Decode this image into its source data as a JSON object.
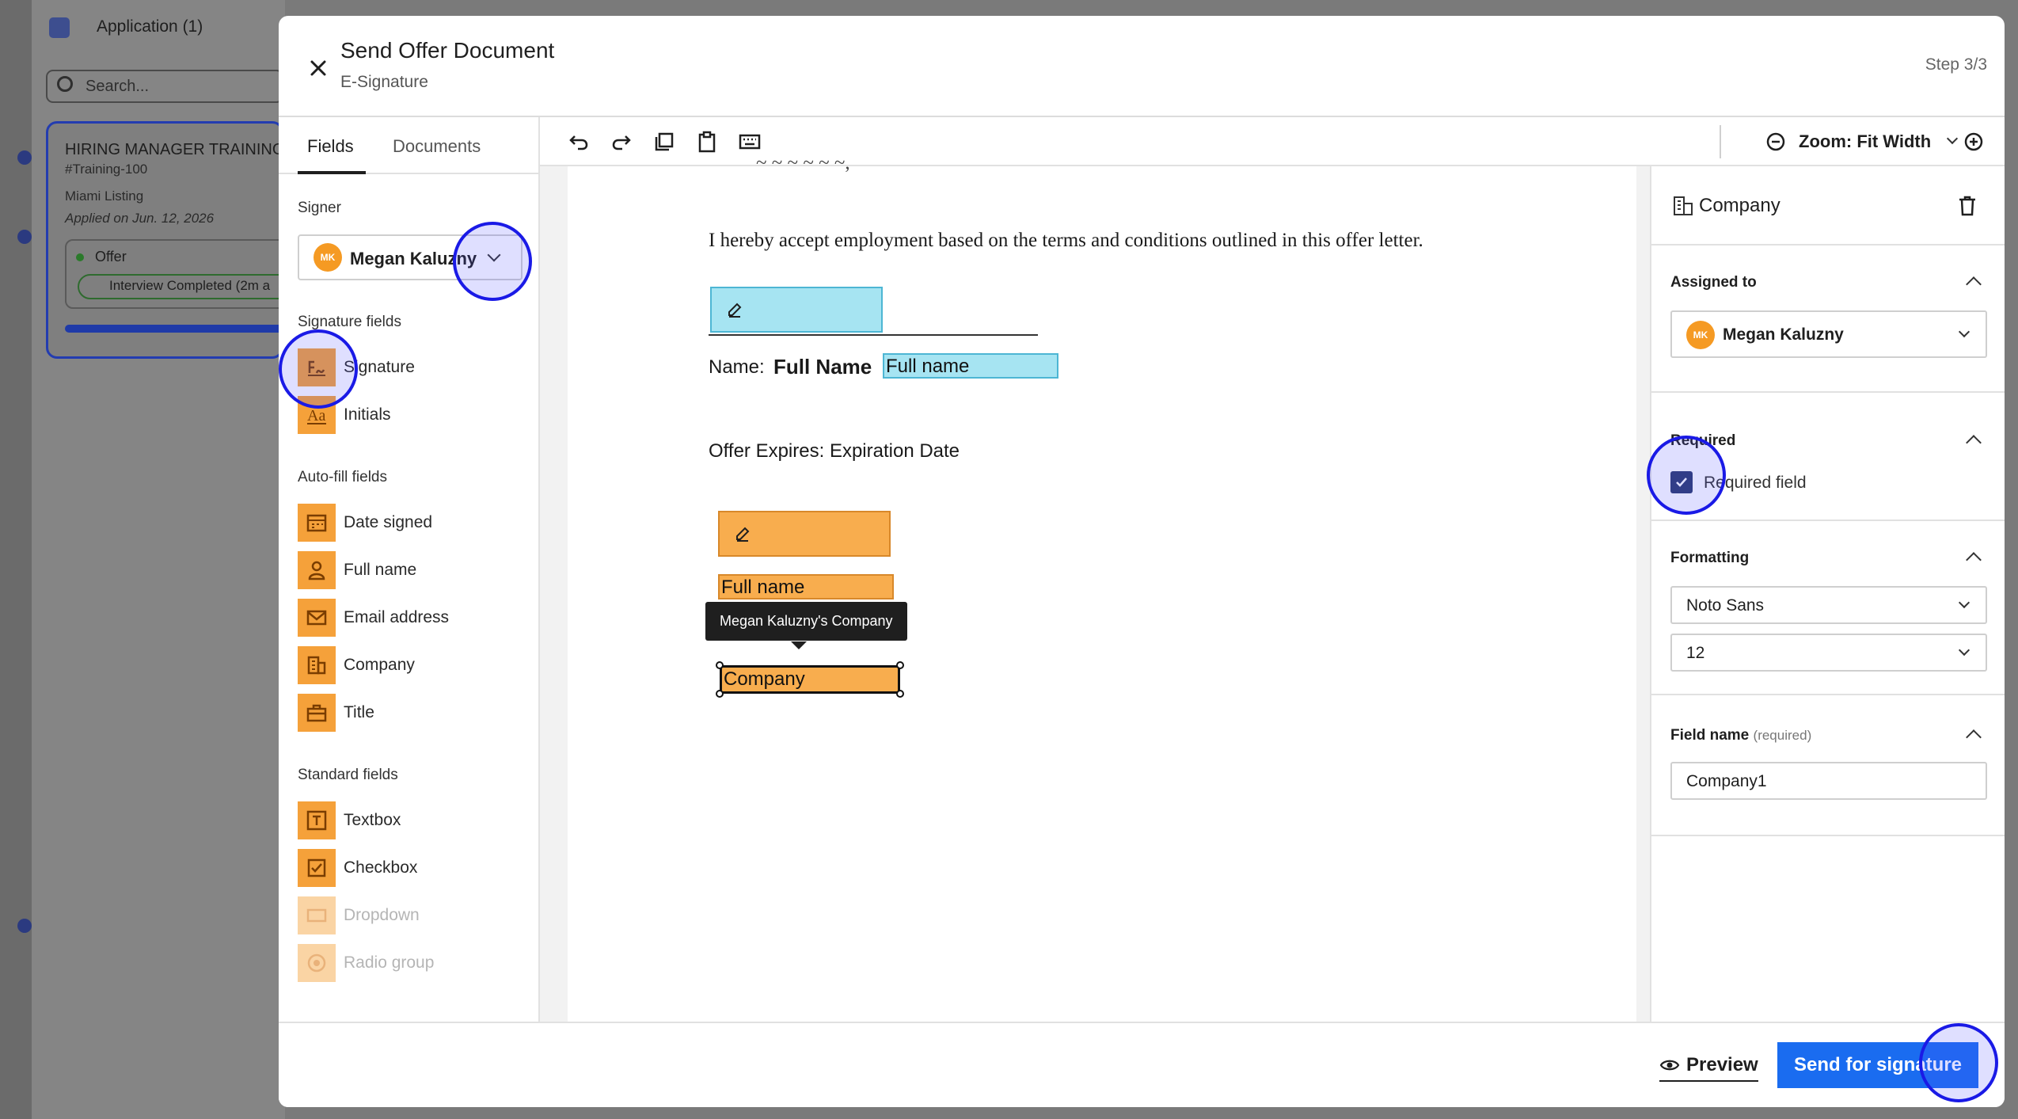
{
  "background": {
    "app_title": "Application (1)",
    "search_placeholder": "Search...",
    "card": {
      "title": "HIRING MANAGER TRAINING",
      "id": "#Training-100",
      "location": "Miami Listing",
      "applied": "Applied on Jun. 12, 2026",
      "stage": "Offer",
      "status": "Interview Completed (2m a"
    }
  },
  "modal": {
    "title": "Send Offer Document",
    "subtitle": "E-Signature",
    "step": "Step 3/3"
  },
  "left": {
    "tabs": [
      "Fields",
      "Documents"
    ],
    "signer_label": "Signer",
    "signer": {
      "initials": "MK",
      "name": "Megan Kaluzny"
    },
    "signature_fields_label": "Signature fields",
    "signature_fields": [
      {
        "label": "Signature",
        "icon": "signature-icon"
      },
      {
        "label": "Initials",
        "icon": "initials-icon"
      }
    ],
    "autofill_label": "Auto-fill fields",
    "autofill_fields": [
      {
        "label": "Date signed",
        "icon": "calendar-icon"
      },
      {
        "label": "Full name",
        "icon": "person-icon"
      },
      {
        "label": "Email address",
        "icon": "mail-icon"
      },
      {
        "label": "Company",
        "icon": "building-icon"
      },
      {
        "label": "Title",
        "icon": "briefcase-icon"
      }
    ],
    "standard_label": "Standard fields",
    "standard_fields": [
      {
        "label": "Textbox",
        "icon": "textbox-icon"
      },
      {
        "label": "Checkbox",
        "icon": "checkbox-icon"
      },
      {
        "label": "Dropdown",
        "icon": "dropdown-icon",
        "disabled": true
      },
      {
        "label": "Radio group",
        "icon": "radio-icon",
        "disabled": true
      }
    ]
  },
  "toolbar": {
    "icons": [
      "undo-icon",
      "redo-icon",
      "copy-icon",
      "paste-icon",
      "keyboard-icon"
    ],
    "zoom_label": "Zoom: Fit Width"
  },
  "document": {
    "partial_top": "~ ~ ~ ~ ~ ~,",
    "accept_text": "I hereby accept employment based on the terms and conditions outlined in this offer letter.",
    "name_prefix": "Name:",
    "name_bold": "Full Name",
    "name_field": "Full name",
    "expires_text": "Offer Expires: Expiration Date",
    "fullname_field": "Full name",
    "company_field": "Company",
    "tooltip": "Megan Kaluzny's Company"
  },
  "right": {
    "field_type": "Company",
    "assigned_label": "Assigned to",
    "assigned": {
      "initials": "MK",
      "name": "Megan Kaluzny"
    },
    "required_label": "Required",
    "required_checkbox_label": "Required field",
    "required_checked": true,
    "formatting_label": "Formatting",
    "font": "Noto Sans",
    "font_size": "12",
    "field_name_label": "Field name",
    "field_name_hint": "(required)",
    "field_name_value": "Company1"
  },
  "footer": {
    "preview_label": "Preview",
    "send_label": "Send for signature"
  },
  "colors": {
    "accent": "#1a6cf0",
    "field_orange": "#f8ad4e",
    "field_blue": "#a6e4f2",
    "avatar": "#f59a23",
    "highlight": "#1a1ae6"
  }
}
